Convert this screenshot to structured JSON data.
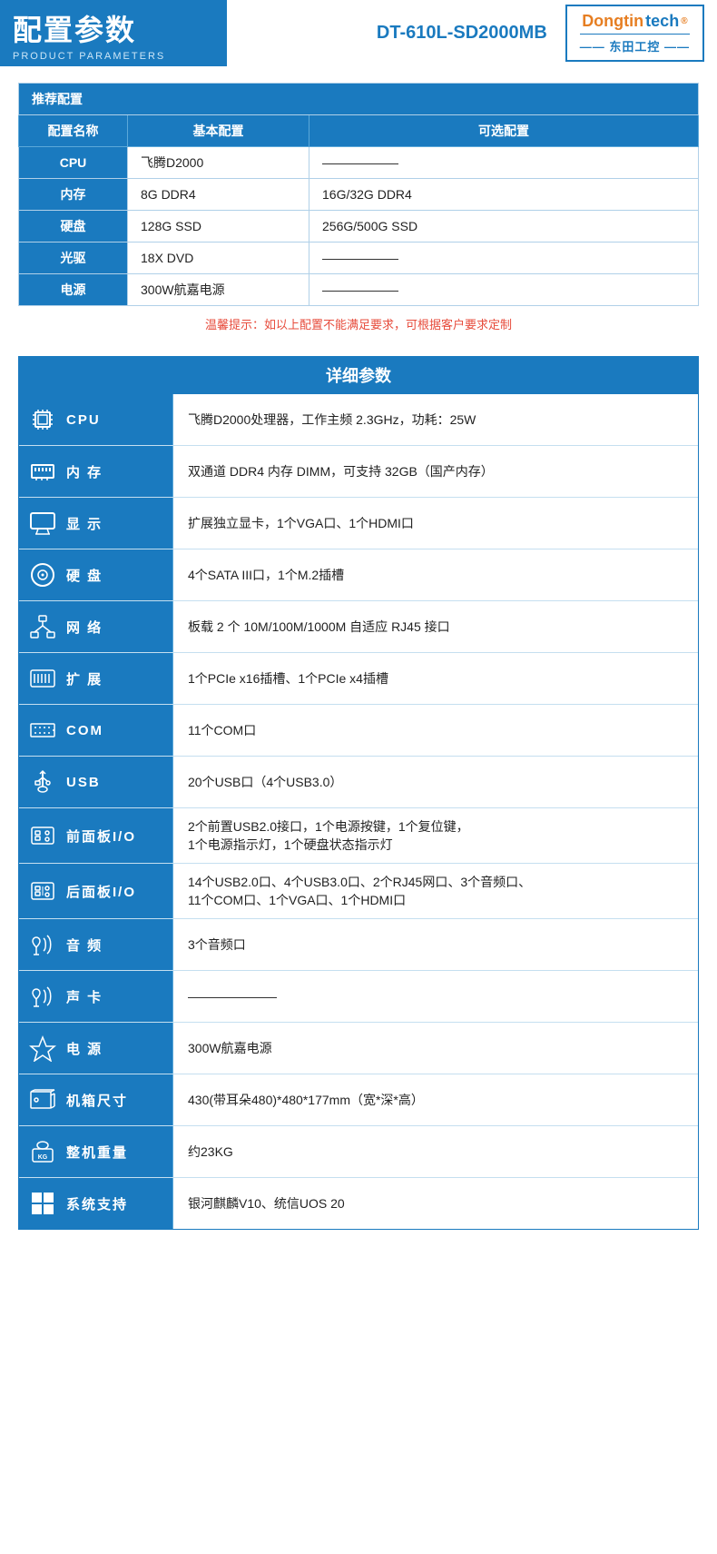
{
  "header": {
    "main_title": "配置参数",
    "sub_title": "PRODUCT PARAMETERS",
    "model": "DT-610L-SD2000MB"
  },
  "logo": {
    "name_orange": "Dongtintech",
    "reg_symbol": "®",
    "name_chinese": "—— 东田工控 ——"
  },
  "recommended": {
    "section_title": "推荐配置",
    "col_name": "配置名称",
    "col_basic": "基本配置",
    "col_optional": "可选配置",
    "rows": [
      {
        "label": "CPU",
        "basic": "飞腾D2000",
        "optional": "——————"
      },
      {
        "label": "内存",
        "basic": "8G DDR4",
        "optional": "16G/32G DDR4"
      },
      {
        "label": "硬盘",
        "basic": "128G SSD",
        "optional": "256G/500G SSD"
      },
      {
        "label": "光驱",
        "basic": "18X DVD",
        "optional": "——————"
      },
      {
        "label": "电源",
        "basic": "300W航嘉电源",
        "optional": "——————"
      }
    ],
    "warn_text": "温馨提示：如以上配置不能满足要求，可根据客户要求定制"
  },
  "detail": {
    "section_title": "详细参数",
    "rows": [
      {
        "id": "cpu",
        "icon": "cpu",
        "label": "CPU",
        "label_spacing": false,
        "value": "飞腾D2000处理器，工作主频 2.3GHz，功耗：25W"
      },
      {
        "id": "memory",
        "icon": "memory",
        "label": "内 存",
        "label_spacing": true,
        "value": "双通道 DDR4 内存 DIMM，可支持 32GB（国产内存）"
      },
      {
        "id": "display",
        "icon": "display",
        "label": "显 示",
        "label_spacing": true,
        "value": "扩展独立显卡，1个VGA口、1个HDMI口"
      },
      {
        "id": "storage",
        "icon": "storage",
        "label": "硬 盘",
        "label_spacing": true,
        "value": "4个SATA III口，1个M.2插槽"
      },
      {
        "id": "network",
        "icon": "network",
        "label": "网 络",
        "label_spacing": true,
        "value": "板载 2 个 10M/100M/1000M 自适应 RJ45 接口"
      },
      {
        "id": "expansion",
        "icon": "expansion",
        "label": "扩 展",
        "label_spacing": true,
        "value": "1个PCIe x16插槽、1个PCIe x4插槽"
      },
      {
        "id": "com",
        "icon": "com",
        "label": "COM",
        "label_spacing": false,
        "value": "11个COM口"
      },
      {
        "id": "usb",
        "icon": "usb",
        "label": "USB",
        "label_spacing": false,
        "value": "20个USB口（4个USB3.0）"
      },
      {
        "id": "front-io",
        "icon": "front-io",
        "label": "前面板I/O",
        "label_spacing": false,
        "value_lines": [
          "2个前置USB2.0接口，1个电源按键，1个复位键，",
          "1个电源指示灯，1个硬盘状态指示灯"
        ]
      },
      {
        "id": "rear-io",
        "icon": "rear-io",
        "label": "后面板I/O",
        "label_spacing": false,
        "value_lines": [
          "14个USB2.0口、4个USB3.0口、2个RJ45网口、3个音频口、",
          "11个COM口、1个VGA口、1个HDMI口"
        ]
      },
      {
        "id": "audio",
        "icon": "audio",
        "label": "音 频",
        "label_spacing": true,
        "value": "3个音频口"
      },
      {
        "id": "soundcard",
        "icon": "soundcard",
        "label": "声 卡",
        "label_spacing": true,
        "value": "———————"
      },
      {
        "id": "power",
        "icon": "power",
        "label": "电 源",
        "label_spacing": true,
        "value": "300W航嘉电源"
      },
      {
        "id": "chassis",
        "icon": "chassis",
        "label": "机箱尺寸",
        "label_spacing": false,
        "value": "430(带耳朵480)*480*177mm（宽*深*高）"
      },
      {
        "id": "weight",
        "icon": "weight",
        "label": "整机重量",
        "label_spacing": false,
        "value": "约23KG"
      },
      {
        "id": "os",
        "icon": "os",
        "label": "系统支持",
        "label_spacing": false,
        "value": "银河麒麟V10、统信UOS 20"
      }
    ]
  }
}
